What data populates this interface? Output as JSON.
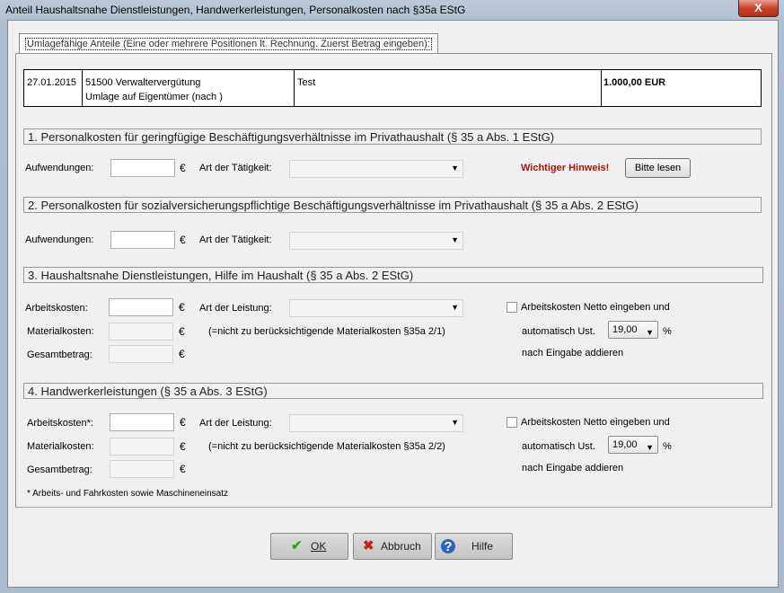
{
  "window": {
    "title": "Anteil Haushaltsnahe Dienstleistungen, Handwerkerleistungen, Personalkosten nach §35a EStG",
    "close_label": "X"
  },
  "tab": {
    "label": "Umlagefähige Anteile (Eine oder mehrere Positionen lt. Rechnung. Zuerst Betrag eingeben):"
  },
  "record": {
    "date": "27.01.2015",
    "line1": "51500 Verwaltervergütung",
    "line2": "Umlage auf Eigentümer (nach )",
    "text": "Test",
    "amount": "1.000,00 EUR"
  },
  "sections": {
    "s1": {
      "title": "1. Personalkosten für geringfügige Beschäftigungsverhältnisse im Privathaushalt (§ 35 a Abs. 1 EStG)",
      "aufwendungen_label": "Aufwendungen:",
      "art_label": "Art der Tätigkeit:",
      "hint_label": "Wichtiger Hinweis!",
      "hint_button": "Bitte lesen"
    },
    "s2": {
      "title": "2. Personalkosten für sozialversicherungspflichtige Beschäftigungsverhältnisse im Privathaushalt (§ 35 a Abs. 2 EStG)",
      "aufwendungen_label": "Aufwendungen:",
      "art_label": "Art der Tätigkeit:"
    },
    "s3": {
      "title": "3. Haushaltsnahe Dienstleistungen, Hilfe im Haushalt (§ 35 a Abs. 2 EStG)",
      "arbeitskosten_label": "Arbeitskosten:",
      "materialkosten_label": "Materialkosten:",
      "gesamtbetrag_label": "Gesamtbetrag:",
      "art_label": "Art der Leistung:",
      "material_note": "(=nicht zu berücksichtigende Materialkosten §35a 2/1)",
      "netto_label": "Arbeitskosten Netto eingeben und",
      "ust_label": "automatisch Ust.",
      "ust_value": "19,00",
      "percent": "%",
      "addieren_label": "nach Eingabe addieren"
    },
    "s4": {
      "title": "4. Handwerkerleistungen (§ 35 a Abs. 3 EStG)",
      "arbeitskosten_label": "Arbeitskosten*:",
      "materialkosten_label": "Materialkosten:",
      "gesamtbetrag_label": "Gesamtbetrag:",
      "art_label": "Art der Leistung:",
      "material_note": "(=nicht zu berücksichtigende Materialkosten §35a 2/2)",
      "netto_label": "Arbeitskosten Netto eingeben und",
      "ust_label": "automatisch Ust.",
      "ust_value": "19,00",
      "percent": "%",
      "addieren_label": "nach Eingabe addieren",
      "footnote": "* Arbeits- und Fahrkosten sowie Maschineneinsatz"
    }
  },
  "currency": "€",
  "footer": {
    "ok_label": "OK",
    "cancel_label": "Abbruch",
    "help_label": "Hilfe"
  }
}
